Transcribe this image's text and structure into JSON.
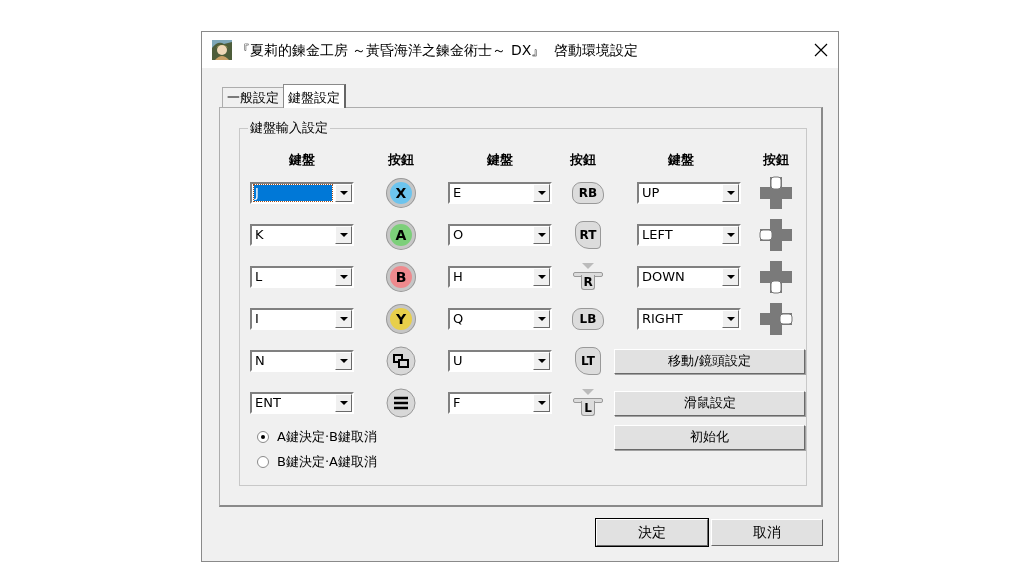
{
  "window": {
    "title": "『夏莉的鍊金工房 ～黃昏海洋之鍊金術士～ DX』  啓動環境設定"
  },
  "tabs": [
    {
      "label": "一般設定",
      "selected": false
    },
    {
      "label": "鍵盤設定",
      "selected": true
    }
  ],
  "group": {
    "title": "鍵盤輸入設定",
    "headers": [
      "鍵盤",
      "按鈕",
      "鍵盤",
      "按鈕",
      "鍵盤",
      "按鈕"
    ],
    "rows": [
      {
        "cells": [
          {
            "key": "J",
            "selected": true,
            "icon": {
              "kind": "face",
              "label": "X",
              "color": "#6cc4ee"
            }
          },
          {
            "key": "E",
            "selected": false,
            "icon": {
              "kind": "bumper",
              "label": "RB"
            }
          },
          {
            "key": "UP",
            "selected": false,
            "icon": {
              "kind": "up"
            }
          }
        ]
      },
      {
        "cells": [
          {
            "key": "K",
            "selected": false,
            "icon": {
              "kind": "face",
              "label": "A",
              "color": "#7ccf7a"
            }
          },
          {
            "key": "O",
            "selected": false,
            "icon": {
              "kind": "trigger",
              "label": "RT"
            }
          },
          {
            "key": "LEFT",
            "selected": false,
            "icon": {
              "kind": "left"
            }
          }
        ]
      },
      {
        "cells": [
          {
            "key": "L",
            "selected": false,
            "icon": {
              "kind": "face",
              "label": "B",
              "color": "#ee8a8e"
            }
          },
          {
            "key": "H",
            "selected": false,
            "icon": {
              "kind": "stick",
              "label": "R"
            }
          },
          {
            "key": "DOWN",
            "selected": false,
            "icon": {
              "kind": "down"
            }
          }
        ]
      },
      {
        "cells": [
          {
            "key": "I",
            "selected": false,
            "icon": {
              "kind": "face",
              "label": "Y",
              "color": "#e8cf4a"
            }
          },
          {
            "key": "Q",
            "selected": false,
            "icon": {
              "kind": "bumper",
              "label": "LB"
            }
          },
          {
            "key": "RIGHT",
            "selected": false,
            "icon": {
              "kind": "right"
            }
          }
        ]
      },
      {
        "cells": [
          {
            "key": "N",
            "selected": false,
            "icon": {
              "kind": "view"
            }
          },
          {
            "key": "U",
            "selected": false,
            "icon": {
              "kind": "trigger",
              "label": "LT"
            }
          }
        ]
      },
      {
        "cells": [
          {
            "key": "ENT",
            "selected": false,
            "icon": {
              "kind": "menu"
            }
          },
          {
            "key": "F",
            "selected": false,
            "icon": {
              "kind": "stick",
              "label": "L"
            }
          }
        ]
      }
    ],
    "side_buttons": [
      "移動/鏡頭設定",
      "滑鼠設定",
      "初始化"
    ],
    "radios": [
      {
        "label": "A鍵決定·B鍵取消",
        "selected": true
      },
      {
        "label": "B鍵決定·A鍵取消",
        "selected": false
      }
    ]
  },
  "footer_buttons": [
    "決定",
    "取消"
  ]
}
